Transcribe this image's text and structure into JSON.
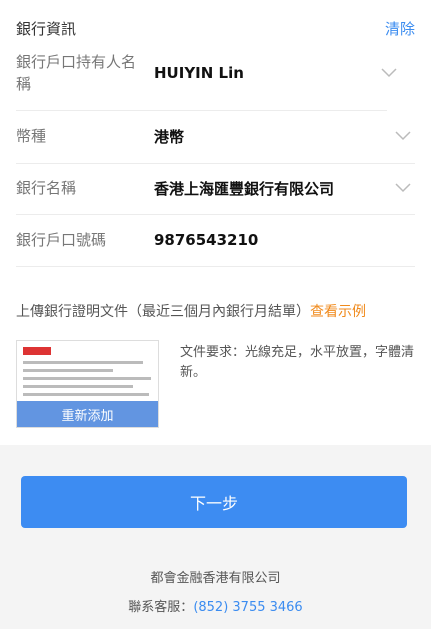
{
  "bank_section": {
    "title": "銀行資訊",
    "clear_label": "清除"
  },
  "fields": [
    {
      "label": "銀行戶口持有人名稱",
      "value": "HUIYIN Lin",
      "has_dropdown": true
    },
    {
      "label": "幣種",
      "value": "港幣",
      "has_dropdown": true
    },
    {
      "label": "銀行名稱",
      "value": "香港上海匯豐銀行有限公司",
      "has_dropdown": true
    },
    {
      "label": "銀行戶口號碼",
      "value": "9876543210",
      "has_dropdown": false
    }
  ],
  "upload": {
    "instruction": "上傳銀行證明文件（最近三個月內銀行月結單）",
    "example_link": "查看示例",
    "readd_label": "重新添加",
    "requirement": "文件要求：光線充足，水平放置，字體清新。"
  },
  "footer": {
    "next_label": "下一步",
    "company": "都會金融香港有限公司",
    "contact_prefix": "聯系客服：",
    "phone": "(852) 3755 3466"
  },
  "colors": {
    "accent": "#3d8cf2",
    "link": "#3b8cf0",
    "example_link": "#f08a1c"
  }
}
